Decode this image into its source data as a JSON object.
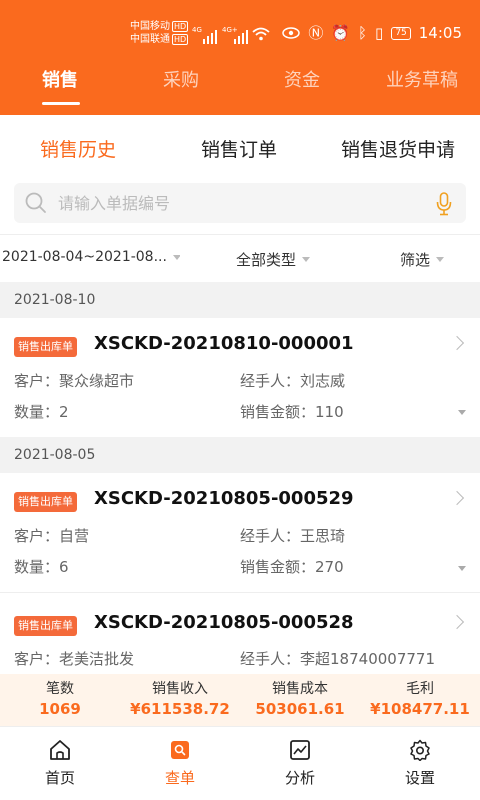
{
  "status_bar": {
    "carrier_1": "中国移动",
    "carrier_2": "中国联通",
    "hd": "HD",
    "net_1": "4G",
    "net_2": "4G+",
    "battery": "75",
    "time": "14:05"
  },
  "top_tabs": [
    {
      "label": "销售",
      "active": true
    },
    {
      "label": "采购",
      "active": false
    },
    {
      "label": "资金",
      "active": false
    },
    {
      "label": "业务草稿",
      "active": false
    }
  ],
  "sub_tabs": [
    {
      "label": "销售历史",
      "active": true
    },
    {
      "label": "销售订单",
      "active": false
    },
    {
      "label": "销售退货申请",
      "active": false
    }
  ],
  "search": {
    "placeholder": "请输入单据编号",
    "value": ""
  },
  "filters": {
    "date_range": "2021-08-04~2021-08...",
    "type": "全部类型",
    "filter": "筛选"
  },
  "groups": [
    {
      "date": "2021-08-10",
      "orders": [
        {
          "badge": "销售出库单",
          "order_no": "XSCKD-20210810-000001",
          "customer_label": "客户：",
          "customer": "聚众缘超市",
          "handler_label": "经手人：",
          "handler": "刘志威",
          "qty_label": "数量：",
          "qty": "2",
          "amount_label": "销售金额：",
          "amount": "110"
        }
      ]
    },
    {
      "date": "2021-08-05",
      "orders": [
        {
          "badge": "销售出库单",
          "order_no": "XSCKD-20210805-000529",
          "customer_label": "客户：",
          "customer": "自营",
          "handler_label": "经手人：",
          "handler": "王思琦",
          "qty_label": "数量：",
          "qty": "6",
          "amount_label": "销售金额：",
          "amount": "270"
        },
        {
          "badge": "销售出库单",
          "order_no": "XSCKD-20210805-000528",
          "customer_label": "客户：",
          "customer": "老美洁批发",
          "handler_label": "经手人：",
          "handler": "李超18740007771"
        }
      ]
    }
  ],
  "summary": [
    {
      "label": "笔数",
      "value": "1069"
    },
    {
      "label": "销售收入",
      "value": "¥611538.72"
    },
    {
      "label": "销售成本",
      "value": "503061.61"
    },
    {
      "label": "毛利",
      "value": "¥108477.11"
    }
  ],
  "bottom_nav": [
    {
      "label": "首页",
      "icon": "home-icon",
      "active": false
    },
    {
      "label": "查单",
      "icon": "search-doc-icon",
      "active": true
    },
    {
      "label": "分析",
      "icon": "chart-icon",
      "active": false
    },
    {
      "label": "设置",
      "icon": "gear-icon",
      "active": false
    }
  ],
  "colors": {
    "brand": "#fa6a1e",
    "badge": "#f46a3a",
    "summary_bg": "#fff4ea"
  }
}
